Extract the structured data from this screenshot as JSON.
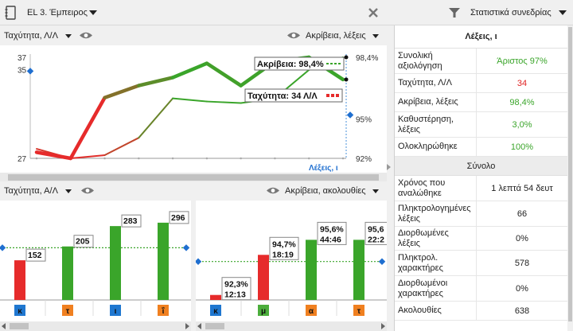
{
  "topbar": {
    "lesson_title": "EL 3. Έμπειρος",
    "stats_title": "Στατιστικά συνεδρίας"
  },
  "chart_top": {
    "left_selector": "Ταχύτητα, Λ/Λ",
    "right_selector": "Ακρίβεια, λέξεις"
  },
  "chart_bottom": {
    "left_selector": "Ταχύτητα, Α/Λ",
    "right_selector": "Ακρίβεια, ακολουθίες"
  },
  "stats": {
    "header": "Λέξεις, ι",
    "rows": [
      {
        "label": "Συνολική αξιολόγηση",
        "value": "Άριστος 97%",
        "color": "#3aa52a"
      },
      {
        "label": "Ταχύτητα, Λ/Λ",
        "value": "34",
        "color": "#e02424"
      },
      {
        "label": "Ακρίβεια, λέξεις",
        "value": "98,4%",
        "color": "#3aa52a"
      },
      {
        "label": "Καθυστέρηση, λέξεις",
        "value": "3,0%",
        "color": "#3aa52a"
      },
      {
        "label": "Ολοκληρώθηκε",
        "value": "100%",
        "color": "#3aa52a"
      }
    ],
    "section": "Σύνολο",
    "rows2": [
      {
        "label": "Χρόνος που αναλώθηκε",
        "value": "1 λεπτά 54 δευτ"
      },
      {
        "label": "Πληκτρολογημένες λέξεις",
        "value": "66"
      },
      {
        "label": "Διορθωμένες λέξεις",
        "value": "0%"
      },
      {
        "label": "Πληκτρολ. χαρακτήρες",
        "value": "578"
      },
      {
        "label": "Διορθωμένοι χαρακτήρες",
        "value": "0%"
      },
      {
        "label": "Ακολουθίες",
        "value": "638"
      }
    ]
  },
  "chart_data": [
    {
      "type": "line",
      "y_left_ticks": [
        "37",
        "35",
        "27"
      ],
      "y_right_ticks": [
        "98,4%",
        "95%",
        "92%"
      ],
      "x_label": "Λέξεις, ι",
      "speed_line": [
        27.6,
        27,
        33,
        34.2,
        35,
        36.4,
        34.2,
        36.6,
        37,
        34.8
      ],
      "accuracy_line": [
        92.6,
        92,
        92.2,
        93.3,
        95.8,
        95.6,
        95.5,
        95.8,
        97.6,
        98.4
      ],
      "tooltip_accuracy": "Ακρίβεια: 98,4%",
      "tooltip_speed": "Ταχύτητα: 34 Λ/Λ",
      "colors": {
        "red": "#e62b2b",
        "green": "#3aa52a",
        "blue": "#1f6fd0"
      }
    },
    {
      "type": "bar",
      "categories": [
        "κ",
        "τ",
        "ι",
        "ΐ"
      ],
      "category_colors": [
        "#1f77d0",
        "#f08020",
        "#1f77d0",
        "#f08020"
      ],
      "values": [
        152,
        205,
        283,
        296
      ],
      "labels": [
        "152",
        "205",
        "283",
        "296"
      ],
      "bar_colors": [
        "#e62b2b",
        "#3aa52a",
        "#3aa52a",
        "#3aa52a"
      ],
      "ylim": [
        0,
        320
      ],
      "avg": 200
    },
    {
      "type": "bar",
      "categories": [
        "κ",
        "μ",
        "α",
        "τ"
      ],
      "category_colors": [
        "#1f77d0",
        "#4cae3c",
        "#f08020",
        "#f08020"
      ],
      "values": [
        92.3,
        94.7,
        95.6,
        95.6
      ],
      "labels_top": [
        "92,3%",
        "94,7%",
        "95,6%",
        "95,6"
      ],
      "labels_bottom": [
        "12:13",
        "18:19",
        "44:46",
        "22:2"
      ],
      "bar_colors": [
        "#e62b2b",
        "#e62b2b",
        "#3aa52a",
        "#3aa52a"
      ],
      "ylim": [
        92,
        97
      ],
      "avg": 94.3
    }
  ]
}
